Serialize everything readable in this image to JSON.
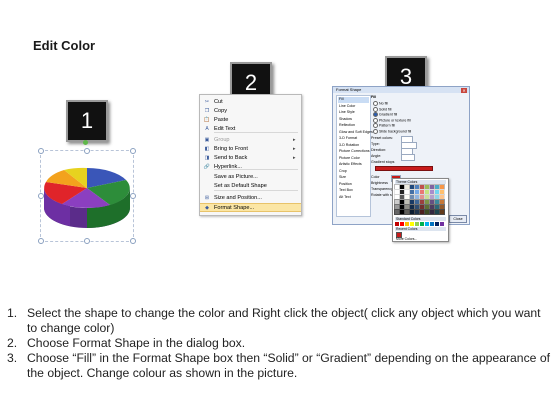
{
  "title": "Edit Color",
  "steps": [
    "1",
    "2",
    "3"
  ],
  "context_menu": {
    "items": [
      {
        "label": "Cut",
        "icon": "scissors-icon",
        "glyph": "✂"
      },
      {
        "label": "Copy",
        "icon": "copy-icon",
        "glyph": "❐"
      },
      {
        "label": "Paste",
        "icon": "paste-icon",
        "glyph": "📋"
      },
      {
        "label": "Edit Text",
        "icon": "edit-text-icon",
        "glyph": "A"
      },
      {
        "label": "Group",
        "icon": "group-icon",
        "glyph": "▣",
        "submenu": true,
        "disabled": true
      },
      {
        "label": "Bring to Front",
        "icon": "bring-front-icon",
        "glyph": "◧",
        "submenu": true
      },
      {
        "label": "Send to Back",
        "icon": "send-back-icon",
        "glyph": "◨",
        "submenu": true
      },
      {
        "label": "Hyperlink...",
        "icon": "hyperlink-icon",
        "glyph": "🔗"
      },
      {
        "label": "Save as Picture...",
        "icon": "",
        "glyph": ""
      },
      {
        "label": "Set as Default Shape",
        "icon": "",
        "glyph": ""
      },
      {
        "label": "Size and Position...",
        "icon": "size-icon",
        "glyph": "⊞"
      },
      {
        "label": "Format Shape...",
        "icon": "format-shape-icon",
        "glyph": "◆",
        "highlighted": true
      }
    ]
  },
  "format_dialog": {
    "title": "Format Shape",
    "categories": [
      "Fill",
      "Line Color",
      "Line Style",
      "Shadow",
      "Reflection",
      "Glow and Soft Edges",
      "3-D Format",
      "3-D Rotation",
      "Picture Corrections",
      "Picture Color",
      "Artistic Effects",
      "Crop",
      "Size",
      "Position",
      "Text Box",
      "Alt Text"
    ],
    "fill_header": "Fill",
    "fill_options": [
      "No fill",
      "Solid fill",
      "Gradient fill",
      "Picture or texture fill",
      "Pattern fill",
      "Slide background fill"
    ],
    "gradient_rows": [
      "Preset colors:",
      "Type:",
      "Direction:",
      "Angle:",
      "Gradient stops"
    ],
    "color_label": "Color",
    "brightness_label": "Brightness",
    "transparency_label": "Transparency",
    "rotate_label": "Rotate with shape",
    "close_label": "Close"
  },
  "color_picker": {
    "theme_label": "Theme Colors",
    "standard_label": "Standard Colors",
    "recent_label": "Recent Colors",
    "more_label": "More Colors...",
    "theme_colors": [
      "#ffffff",
      "#000000",
      "#eeece1",
      "#1f497d",
      "#4f81bd",
      "#c0504d",
      "#9bbb59",
      "#8064a2",
      "#4bacc6",
      "#f79646"
    ],
    "standard_colors": [
      "#c00000",
      "#ff0000",
      "#ffc000",
      "#ffff00",
      "#92d050",
      "#00b050",
      "#00b0f0",
      "#0070c0",
      "#002060",
      "#7030a0"
    ]
  },
  "instructions": [
    {
      "num": "1.",
      "text": "Select the shape to change the color and Right click the object( click any object which you want to change color)"
    },
    {
      "num": "2.",
      "text": "Choose Format Shape in the dialog box."
    },
    {
      "num": "3.",
      "text": "Choose “Fill” in the Format Shape box then “Solid” or “Gradient” depending on the appearance of the object. Change colour as shown in the picture."
    }
  ]
}
